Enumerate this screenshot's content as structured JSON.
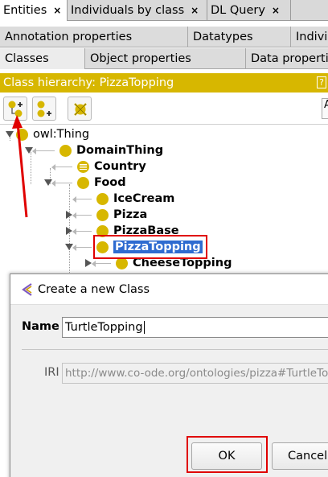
{
  "top_tabs": [
    {
      "label": "Entities",
      "close": "×"
    },
    {
      "label": "Individuals by class",
      "close": "×"
    },
    {
      "label": "DL Query",
      "close": "×"
    }
  ],
  "property_tabs_row1": [
    "Annotation properties",
    "Datatypes",
    "Indivi"
  ],
  "property_tabs_row2": [
    "Classes",
    "Object properties",
    "Data properti"
  ],
  "view": {
    "header": "Class hierarchy: PizzaTopping",
    "help_glyph": "?",
    "toolbar_right_glyph": "A"
  },
  "tree": {
    "nodes": [
      {
        "label": "owl:Thing"
      },
      {
        "label": "DomainThing"
      },
      {
        "label": "Country"
      },
      {
        "label": "Food"
      },
      {
        "label": "IceCream"
      },
      {
        "label": "Pizza"
      },
      {
        "label": "PizzaBase"
      },
      {
        "label": "PizzaTopping",
        "selected": true
      },
      {
        "label": "CheeseTopping"
      }
    ]
  },
  "dialog": {
    "title": "Create a new Class",
    "name_label": "Name",
    "name_value": "TurtleTopping",
    "iri_label": "IRI",
    "iri_value": "http://www.co-ode.org/ontologies/pizza#TurtleTo",
    "ok_label": "OK",
    "cancel_label": "Cancel"
  },
  "colors": {
    "accent": "#d7b700",
    "selection": "#2e6bd0",
    "annotation_red": "#e00000"
  }
}
